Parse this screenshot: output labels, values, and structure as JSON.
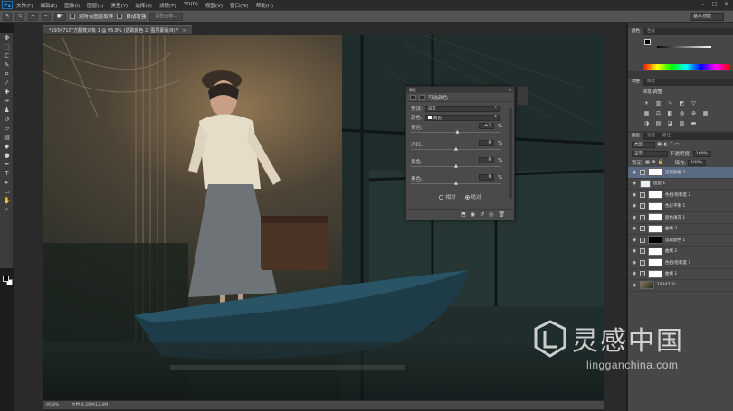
{
  "app": {
    "logo": "Ps"
  },
  "menu": [
    "文件(F)",
    "编辑(E)",
    "图像(I)",
    "图层(L)",
    "类型(Y)",
    "选择(S)",
    "滤镜(T)",
    "3D(D)",
    "视图(V)",
    "窗口(W)",
    "帮助(H)"
  ],
  "options_bar": {
    "sample_all_layers": "对所有图层取样",
    "auto_enhance": "自动增强",
    "refine_edge": "调整边缘..."
  },
  "workspace": "基本功能",
  "document": {
    "tab_title": "*1934710\"方翻蒸对象 1 @ 95.8% (选取颜色 2, 图层蒙版/8) *",
    "zoom": "95.8%",
    "doc_size": "文档:4.29M/12.6M"
  },
  "properties": {
    "panel_label": "属性",
    "title": "可选颜色",
    "preset_label": "预设:",
    "preset_value": "自定",
    "colors_label": "颜色:",
    "colors_value": "白色",
    "sliders": [
      {
        "label": "青色:",
        "value": "+3",
        "unit": "%",
        "position": 0.515
      },
      {
        "label": "洋红:",
        "value": "0",
        "unit": "%",
        "position": 0.5
      },
      {
        "label": "黄色:",
        "value": "0",
        "unit": "%",
        "position": 0.5
      },
      {
        "label": "黑色:",
        "value": "0",
        "unit": "%",
        "position": 0.5
      }
    ],
    "radio_relative": "相对",
    "radio_absolute": "绝对",
    "selected_mode": "absolute"
  },
  "right_panels": {
    "color_tabs": [
      "颜色",
      "色板"
    ],
    "adjust_tabs": [
      "调整",
      "样式"
    ],
    "adjust_title": "添加调整",
    "layer_tabs": [
      "图层",
      "通道",
      "路径"
    ],
    "layer_kind": "类型",
    "blend_mode": "正常",
    "opacity_label": "不透明度:",
    "opacity": "100%",
    "lock_label": "锁定:",
    "fill_label": "填充:",
    "fill": "100%"
  },
  "layers": [
    {
      "name": "选取颜色 2",
      "selected": true,
      "mask": "white"
    },
    {
      "name": "图层 1",
      "selected": false,
      "mask": "none"
    },
    {
      "name": "色相/饱和度 2",
      "selected": false,
      "mask": "white"
    },
    {
      "name": "色彩平衡 1",
      "selected": false,
      "mask": "white"
    },
    {
      "name": "颜色填充 1",
      "selected": false,
      "mask": "white"
    },
    {
      "name": "曲线 3",
      "selected": false,
      "mask": "white"
    },
    {
      "name": "选取颜色 1",
      "selected": false,
      "mask": "black"
    },
    {
      "name": "曲线 2",
      "selected": false,
      "mask": "white"
    },
    {
      "name": "色相/饱和度 1",
      "selected": false,
      "mask": "white"
    },
    {
      "name": "曲线 1",
      "selected": false,
      "mask": "white"
    },
    {
      "name": "1934710",
      "selected": false,
      "mask": "photo"
    }
  ],
  "watermark": {
    "title": "灵感中国",
    "url": "lingganchina.com"
  }
}
